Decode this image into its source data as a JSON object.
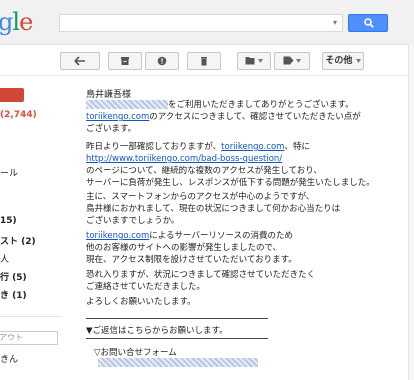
{
  "header": {
    "logo_letters": [
      "g",
      "l",
      "e"
    ],
    "search_placeholder": "",
    "search_caret": "▾"
  },
  "toolbar": {
    "more_label": "その他"
  },
  "sidebar": {
    "count": "(2,744)",
    "item_label_1": "ール",
    "item_label_2": "15)",
    "item_label_3": "スト (2)",
    "item_label_4": "人",
    "item_label_5": "行 (5)",
    "item_label_6": "き (1)",
    "input_placeholder": "アウト",
    "item_label_7": "きん"
  },
  "email": {
    "greeting": "鳥井謙吾様",
    "p1_line1_suffix": "をご利用いただきましてありがとうございます。",
    "p1_line2_link": "toriikengo.com",
    "p1_line2_text": "のアクセスにつきまして、確認させていただきたい点が",
    "p1_line3": "ございます。",
    "p2_line1_pre": "昨日より一部確認しておりますが、",
    "p2_line1_link": "toriikengo.com",
    "p2_line1_post": "、特に",
    "p2_line2_link": "http://www.toriikengo.com/bad-boss-question/",
    "p2_line3": "のページについて、継続的な複数のアクセスが発生しており、",
    "p2_line4": "サーバーに負荷が発生し、レスポンスが低下する問題が発生いたしました。",
    "p3_line1": "主に、スマートフォンからのアクセスが中心のようですが、",
    "p3_line2": "鳥井様におかれまして、現在の状況につきまして何かお心当たりは",
    "p3_line3": "ございますでしょうか。",
    "p4_line1_link": "toriikengo.com",
    "p4_line1_text": "によるサーバーリソースの消費のため",
    "p4_line2": "他のお客様のサイトへの影響が発生しましたので、",
    "p4_line3": "現在、アクセス制限を設けさせていただいております。",
    "p5_line1": "恐れ入りますが、状況につきまして確認させていただきたく",
    "p5_line2": "ご連絡させていただきました。",
    "p6": "よろしくお願いいたします。",
    "reply_note": "▼ご返信はこちらからお願いします。",
    "form_label": "▽お問い合せフォーム"
  }
}
